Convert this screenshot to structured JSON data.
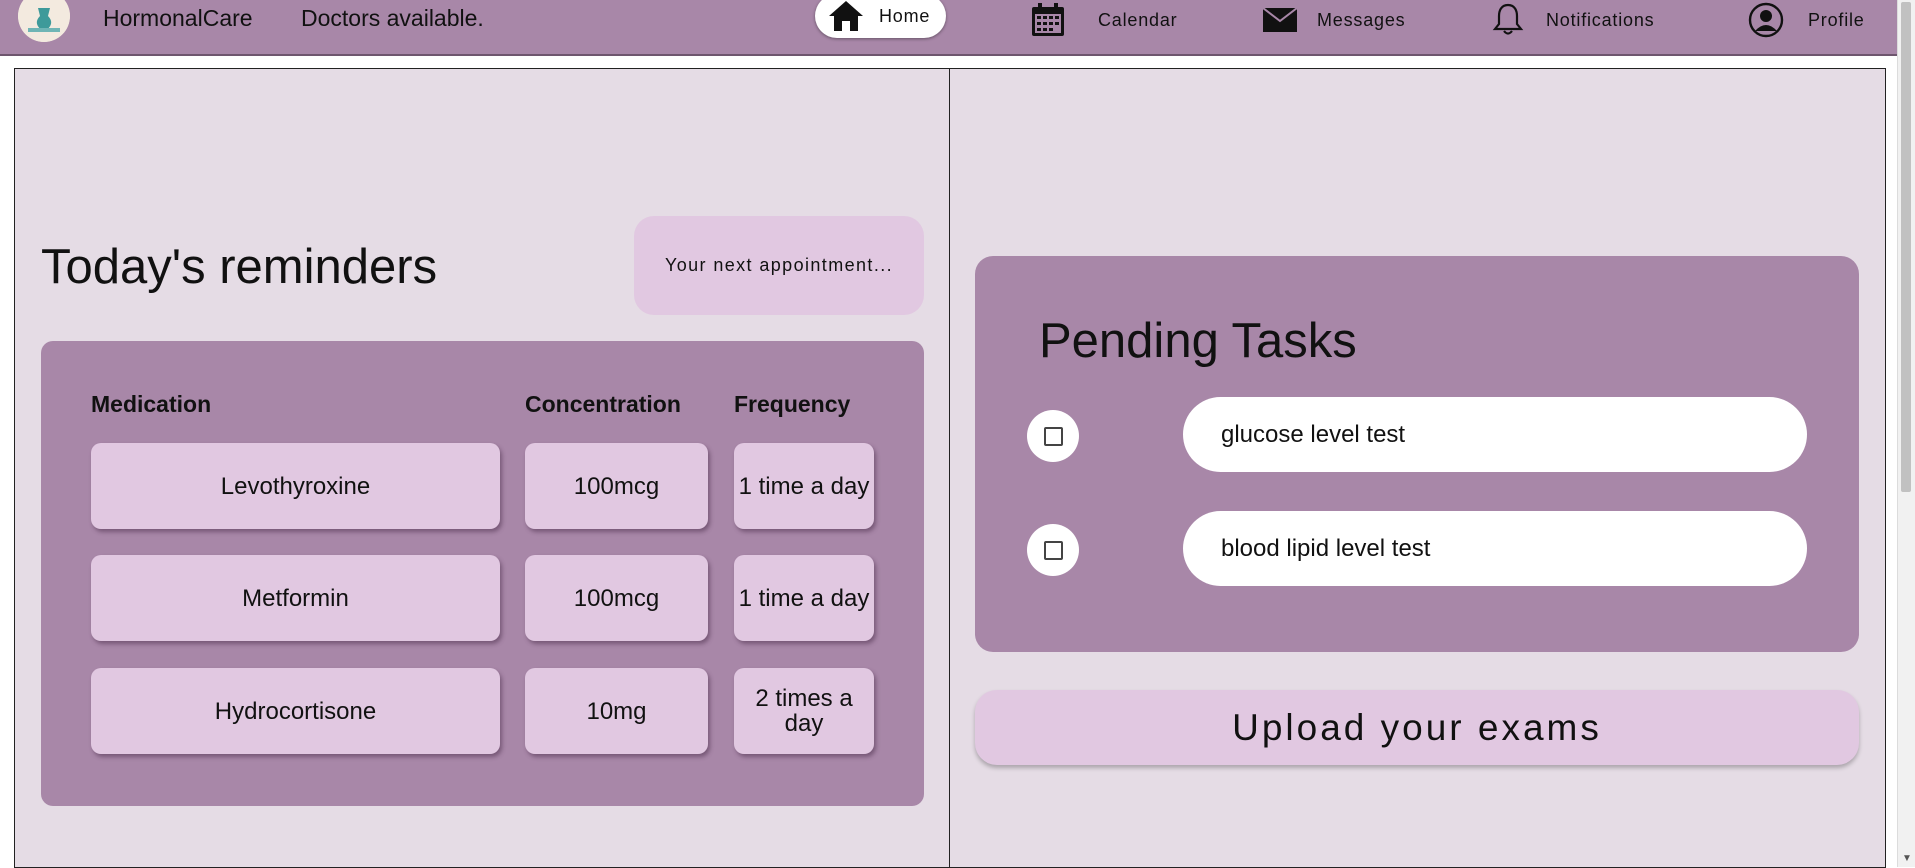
{
  "header": {
    "brand": "HormonalCare",
    "tagline": "Doctors available.",
    "nav": [
      {
        "label": "Home",
        "icon": "home-icon",
        "active": true
      },
      {
        "label": "Calendar",
        "icon": "calendar-icon",
        "active": false
      },
      {
        "label": "Messages",
        "icon": "envelope-icon",
        "active": false
      },
      {
        "label": "Notifications",
        "icon": "bell-icon",
        "active": false
      },
      {
        "label": "Profile",
        "icon": "user-icon",
        "active": false
      }
    ]
  },
  "reminders": {
    "title": "Today's reminders",
    "next_appointment": "Your next appointment...",
    "columns": [
      "Medication",
      "Concentration",
      "Frequency"
    ],
    "rows": [
      {
        "medication": "Levothyroxine",
        "concentration": "100mcg",
        "frequency": "1 time a day"
      },
      {
        "medication": "Metformin",
        "concentration": "100mcg",
        "frequency": "1 time a day"
      },
      {
        "medication": "Hydrocortisone",
        "concentration": "10mg",
        "frequency": "2 times a day"
      }
    ]
  },
  "tasks": {
    "title": "Pending Tasks",
    "items": [
      {
        "label": "glucose level test",
        "checked": false
      },
      {
        "label": "blood lipid level test",
        "checked": false
      }
    ]
  },
  "upload": {
    "label": "Upload your exams"
  },
  "colors": {
    "header_bg": "#a887a8",
    "panel_bg": "#e5dce5",
    "card_bg": "#a887a8",
    "light_card": "#e1c8e1"
  }
}
